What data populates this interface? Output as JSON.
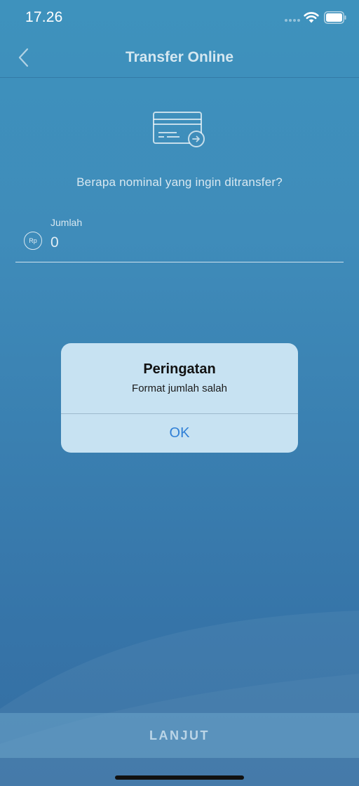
{
  "status_bar": {
    "time": "17.26",
    "icons": [
      "signal-icon",
      "wifi-icon",
      "battery-icon"
    ]
  },
  "nav": {
    "title": "Transfer Online",
    "back_icon": "chevron-left-icon"
  },
  "content": {
    "illustration_icon": "card-transfer-icon",
    "question": "Berapa nominal yang ingin ditransfer?",
    "amount_field": {
      "label": "Jumlah",
      "currency_icon_text": "Rp",
      "value": "0"
    }
  },
  "footer": {
    "next_label": "LANJUT"
  },
  "alert": {
    "title": "Peringatan",
    "message": "Format jumlah salah",
    "ok_label": "OK"
  },
  "colors": {
    "background_top": "#3e92bd",
    "background_bottom": "#346ea2",
    "alert_background": "#c7e2f2",
    "alert_button": "#2f7fd6"
  }
}
